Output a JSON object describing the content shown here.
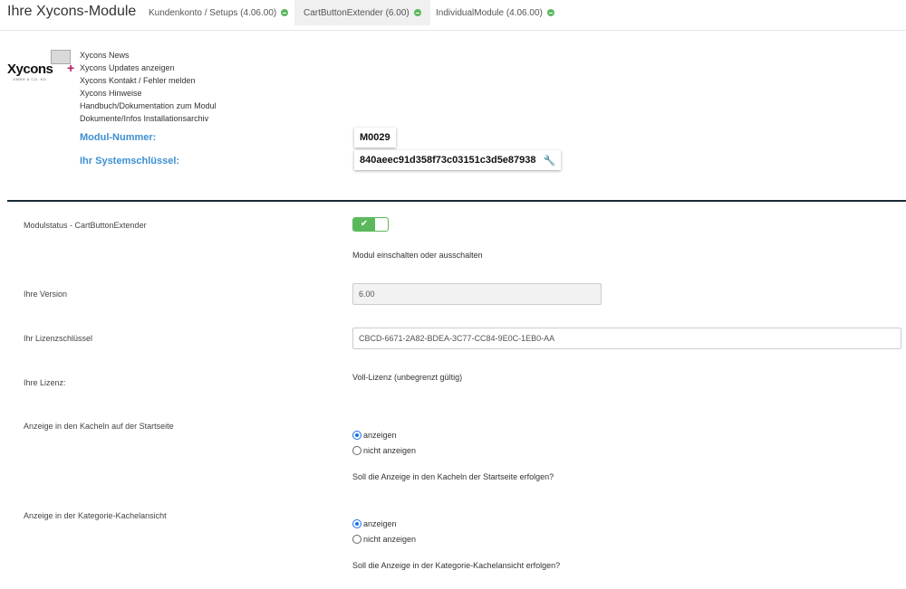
{
  "header": {
    "title": "Ihre Xycons-Module",
    "tabs": [
      {
        "label": "Kundenkonto / Setups (4.06.00)"
      },
      {
        "label": "CartButtonExtender (6.00)"
      },
      {
        "label": "IndividualModule (4.06.00)"
      }
    ]
  },
  "logo": {
    "text": "Xycons",
    "sub": "GMBH & CO. KG"
  },
  "links": [
    "Xycons News",
    "Xycons Updates anzeigen",
    "Xycons Kontakt / Fehler melden",
    "Xycons Hinweise",
    "Handbuch/Dokumentation zum Modul",
    "Dokumente/Infos Installationsarchiv"
  ],
  "module_info": {
    "number_label": "Modul-Nummer:",
    "number_value": "M0029",
    "key_label": "Ihr Systemschlüssel:",
    "key_value": "840aeec91d358f73c03151c3d5e87938"
  },
  "settings": {
    "status_label": "Modulstatus - CartButtonExtender",
    "status_check": "✔",
    "status_help": "Modul einschalten oder ausschalten",
    "version_label": "Ihre Version",
    "version_value": "6.00",
    "license_key_label": "Ihr Lizenzschlüssel",
    "license_key_value": "CBCD-6671-2A82-BDEA-3C77-CC84-9E0C-1EB0-AA",
    "license_label": "Ihre Lizenz:",
    "license_value": "Voll-Lizenz (unbegrenzt gültig)",
    "start_label": "Anzeige in den Kacheln auf der Startseite",
    "start_opt_show": "anzeigen",
    "start_opt_hide": "nicht anzeigen",
    "start_help": "Soll die Anzeige in den Kacheln der Startseite erfolgen?",
    "cat_label": "Anzeige in der Kategorie-Kachelansicht",
    "cat_opt_show": "anzeigen",
    "cat_opt_hide": "nicht anzeigen",
    "cat_help": "Soll die Anzeige in der Kategorie-Kachelansicht erfolgen?"
  },
  "colors": {
    "accent": "#3d8fd1",
    "toggle_on": "#5cb85c",
    "divider": "#1c2b33"
  }
}
